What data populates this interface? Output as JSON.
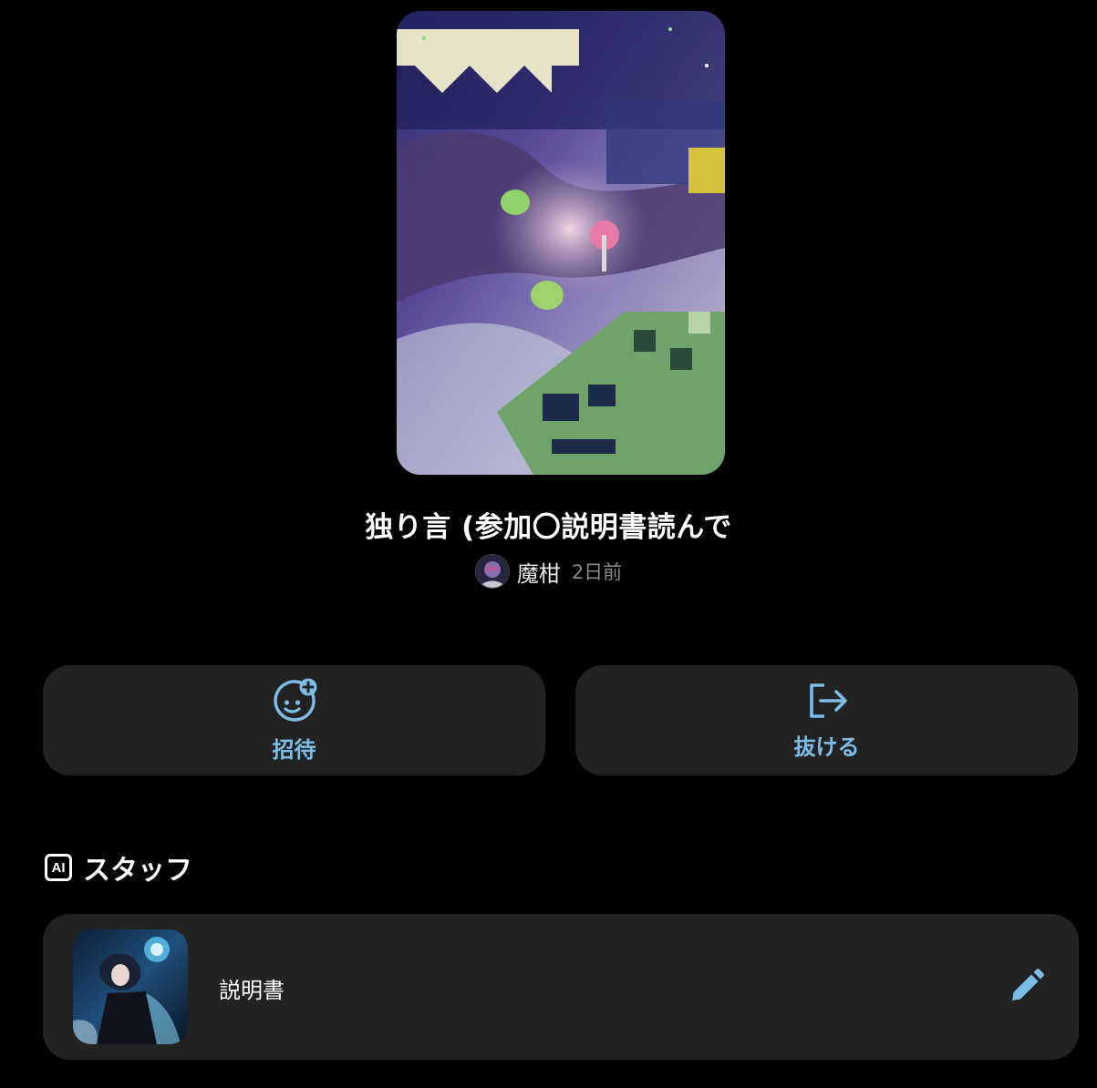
{
  "chat": {
    "title": "独り言 (参加〇説明書読んで",
    "author": "魔柑",
    "time_ago": "2日前"
  },
  "actions": {
    "invite_label": "招待",
    "leave_label": "抜ける"
  },
  "staff": {
    "section_badge": "AI",
    "section_title": "スタッフ",
    "items": [
      {
        "name": "説明書"
      }
    ]
  },
  "icons": {
    "invite": "smiley-plus-icon",
    "leave": "logout-icon",
    "edit": "pencil-icon"
  },
  "colors": {
    "accent": "#7cbde8",
    "card_bg": "#222222",
    "page_bg": "#000000"
  }
}
